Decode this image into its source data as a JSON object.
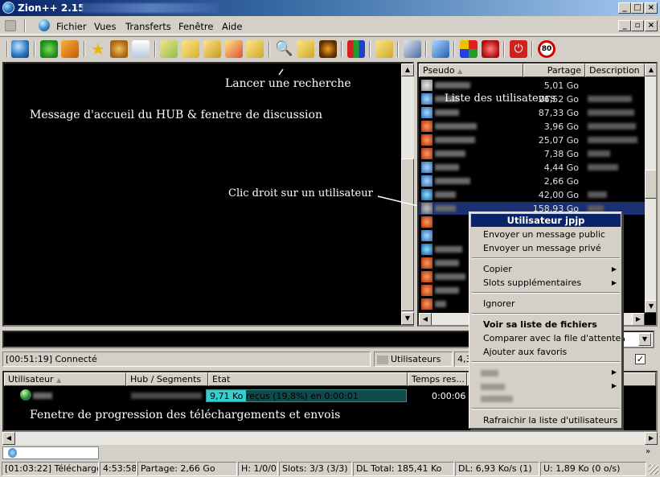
{
  "window": {
    "title": "Zion++ 2.15 -"
  },
  "menu": [
    "Fichier",
    "Vues",
    "Transferts",
    "Fenêtre",
    "Aide"
  ],
  "annotations": {
    "search": "Lancer une recherche",
    "welcome": "Message d'accueil du HUB & fenetre de discussion",
    "users": "Liste des utilisateurs",
    "rightclick": "Clic droit sur un utilisateur",
    "progress": "Fenetre de progression des téléchargements et envois"
  },
  "userlist": {
    "columns": [
      "Pseudo",
      "Partage",
      "Description"
    ],
    "shares": [
      "5,01 Go",
      "26,52 Go",
      "87,33 Go",
      "3,96 Go",
      "25,07 Go",
      "7,38 Go",
      "4,44 Go",
      "2,66 Go",
      "42,00 Go",
      "158,93 Go"
    ]
  },
  "context_menu": {
    "title": "Utilisateur jpjp",
    "items": {
      "public_msg": "Envoyer un message public",
      "private_msg": "Envoyer un message privé",
      "copy": "Copier",
      "slots": "Slots supplémentaires",
      "ignore": "Ignorer",
      "filelist": "Voir sa liste de fichiers",
      "compare": "Comparer avec la file d'attente",
      "favorites": "Ajouter aux favoris",
      "refresh": "Rafraichir la liste d'utilisateurs"
    }
  },
  "hub_combo": "o",
  "chat_status": {
    "time": "[00:51:19] Connecté",
    "users_label": "Utilisateurs",
    "users_count": "4,3"
  },
  "transfers": {
    "columns": [
      "Utilisateur",
      "Hub / Segments",
      "Etat",
      "Temps res..."
    ],
    "row": {
      "status": "9,71 Ko reçus (19,8%) en 0:00:01",
      "time_left": "0:00:06",
      "progress": 0.198
    }
  },
  "statusbar": [
    "[01:03:22] Téléchargem",
    "4:53:58",
    "Partage: 2,66 Go",
    "H: 1/0/0",
    "Slots: 3/3 (3/3)",
    "DL Total: 185,41 Ko",
    "DL: 6,93 Ko/s (1)",
    "U: 1,89 Ko (0 o/s)"
  ]
}
